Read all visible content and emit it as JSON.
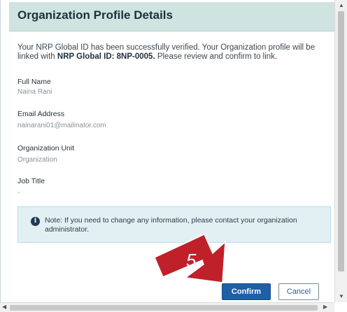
{
  "dialog": {
    "title": "Organization Profile Details",
    "intro_prefix": "Your NRP Global ID has been successfully verified. Your Organization profile will be linked with ",
    "intro_bold": "NRP Global ID: 8NP-0005.",
    "intro_suffix": " Please review and confirm to link."
  },
  "fields": {
    "full_name_label": "Full Name",
    "full_name_value": "Naina Rani",
    "email_label": "Email Address",
    "email_value": "nainarani01@mailinator.com",
    "org_unit_label": "Organization Unit",
    "org_unit_value": "Organization",
    "job_title_label": "Job Title",
    "job_title_value": "-"
  },
  "note": {
    "icon": "info-icon",
    "icon_glyph": "i",
    "text": "Note: If you need to change any information, please contact your organization administrator."
  },
  "callout": {
    "step": "5",
    "color": "#c0202a"
  },
  "buttons": {
    "confirm_label": "Confirm",
    "cancel_label": "Cancel"
  },
  "colors": {
    "header_bg": "#cfe3e0",
    "note_bg": "#e2f0f4",
    "primary": "#1f5fa8"
  }
}
